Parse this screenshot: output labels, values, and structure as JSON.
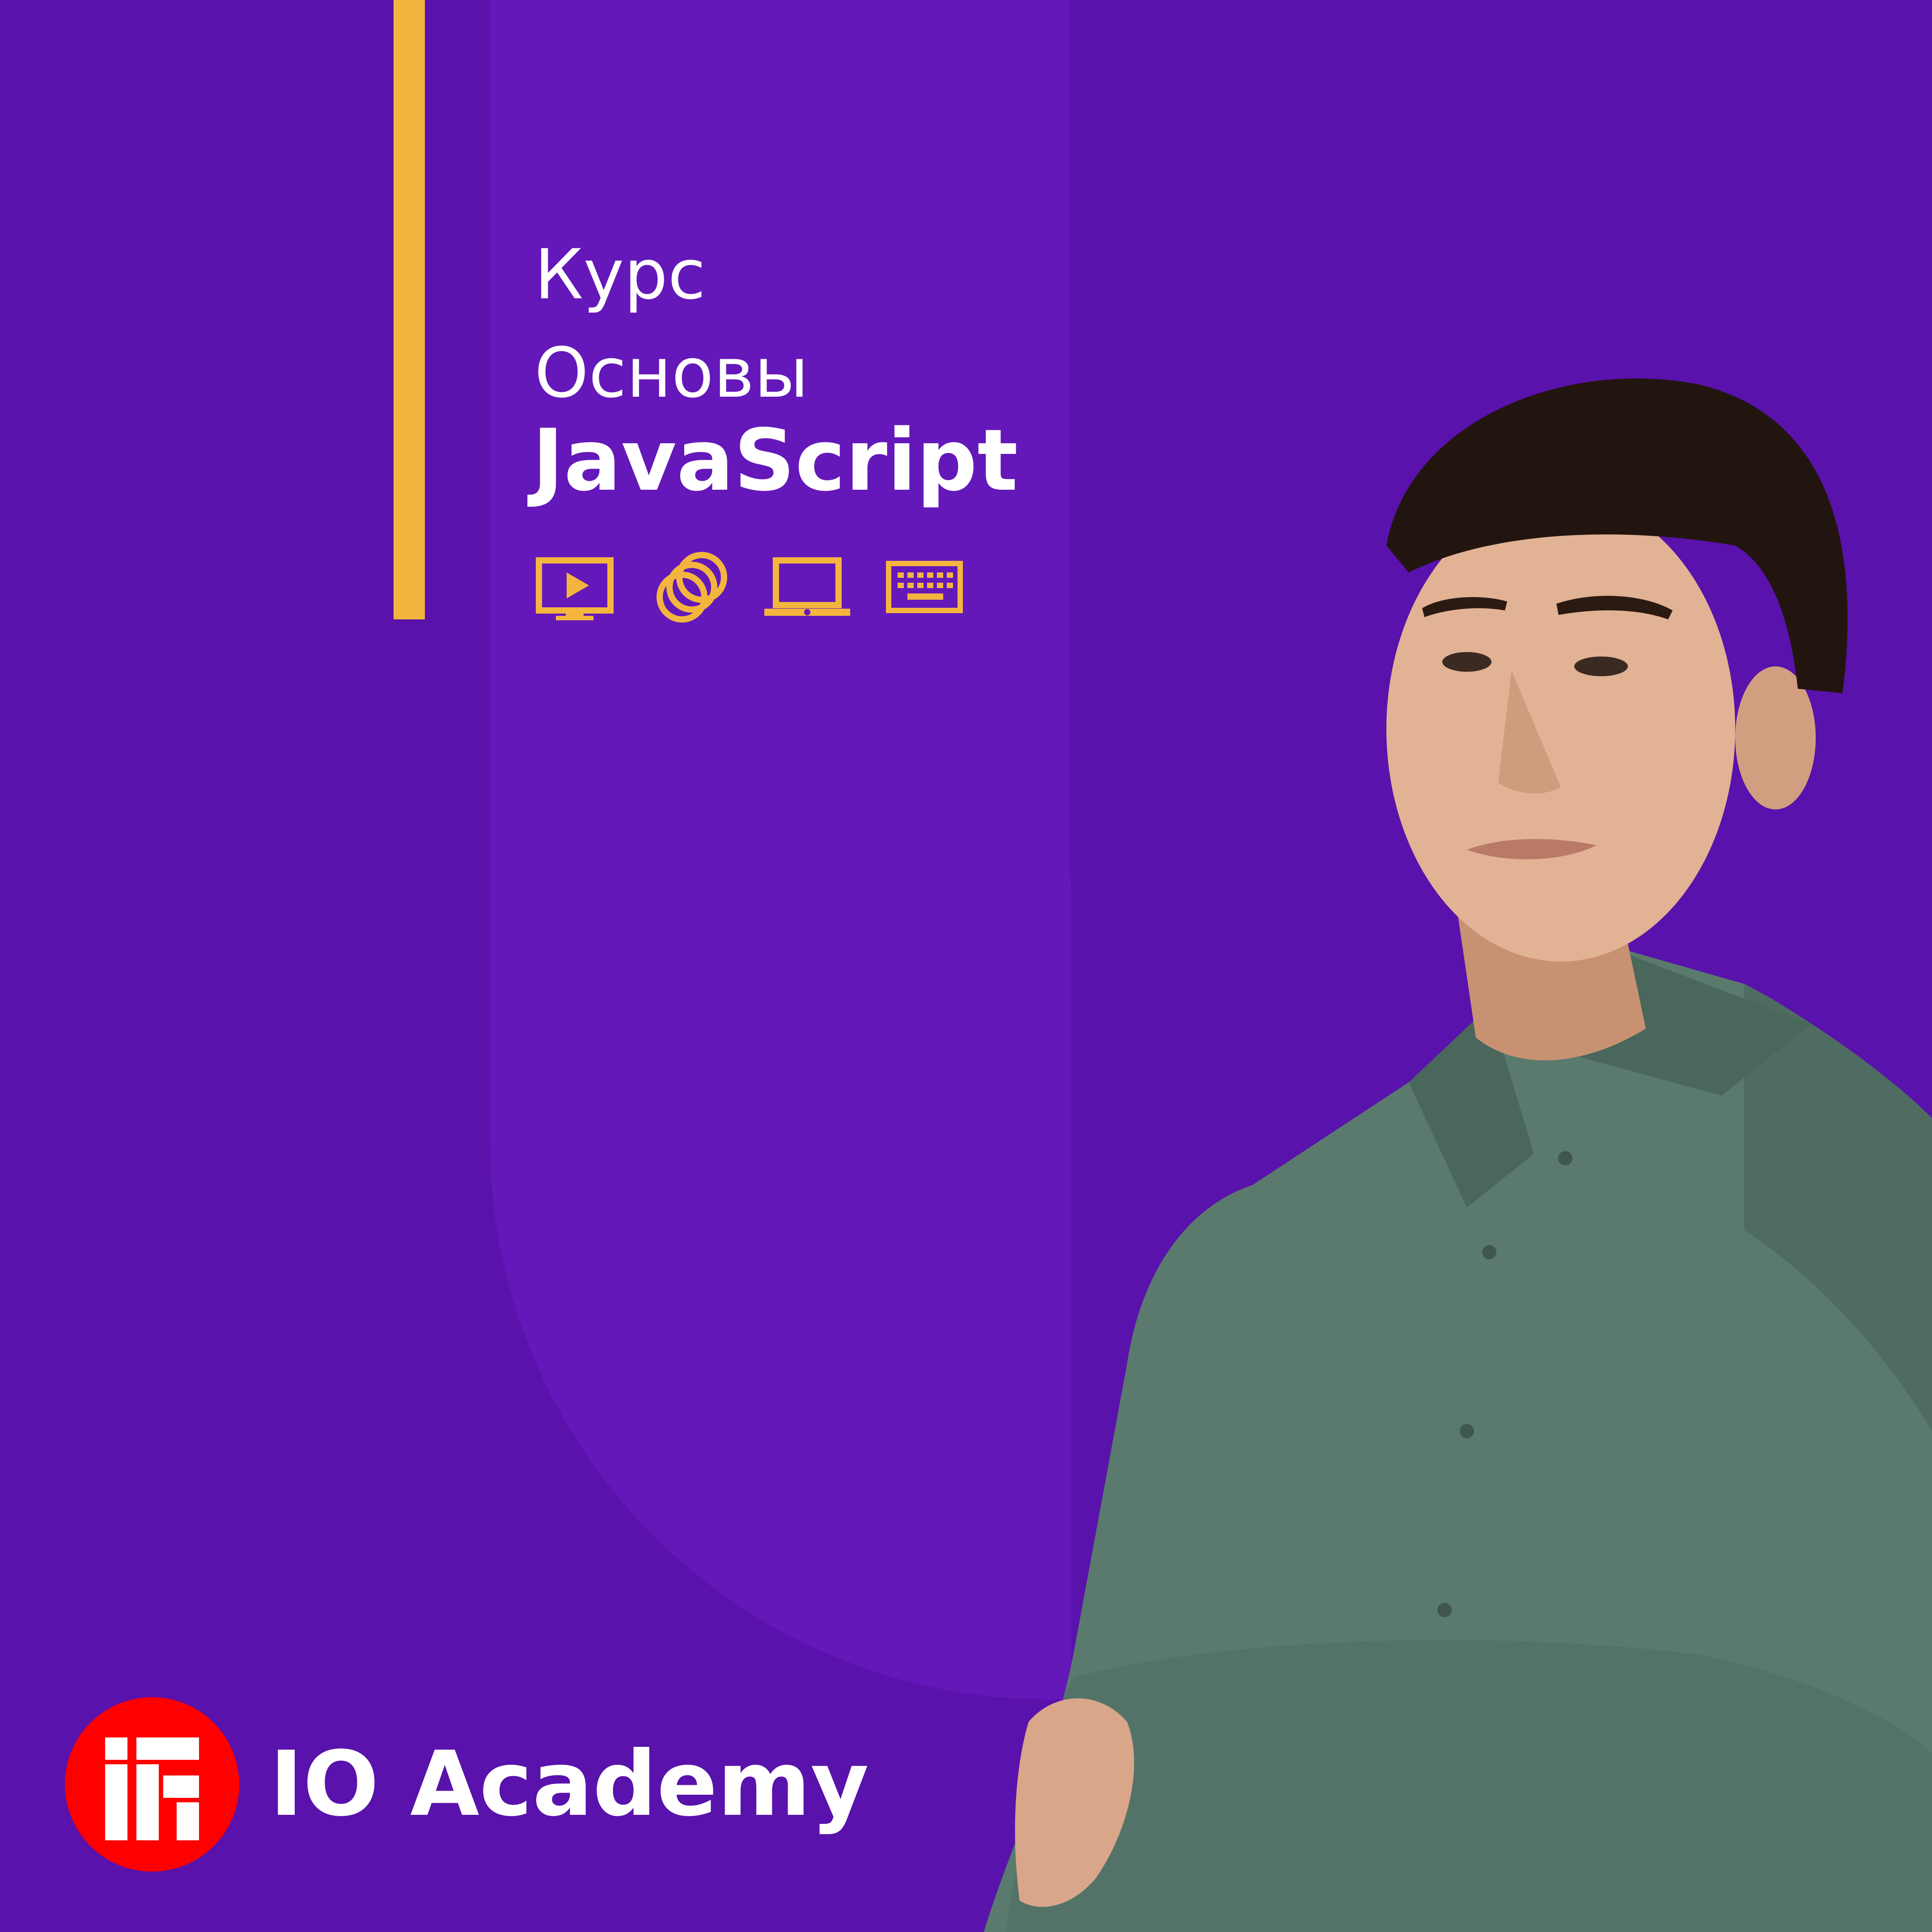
{
  "course": {
    "line1": "Курс",
    "line2": "Основы",
    "title": "JavaScript"
  },
  "icons": [
    "video-play-icon",
    "coins-icon",
    "laptop-icon",
    "keyboard-icon"
  ],
  "brand": {
    "name": "IO Academy",
    "logo": "io-academy-logo"
  },
  "colors": {
    "background": "#5912AB",
    "panel": "#6418B9",
    "accent": "#F4B53F",
    "text": "#FFFFFF",
    "logo_red": "#FF0000",
    "shirt": "#5A7A6E"
  }
}
